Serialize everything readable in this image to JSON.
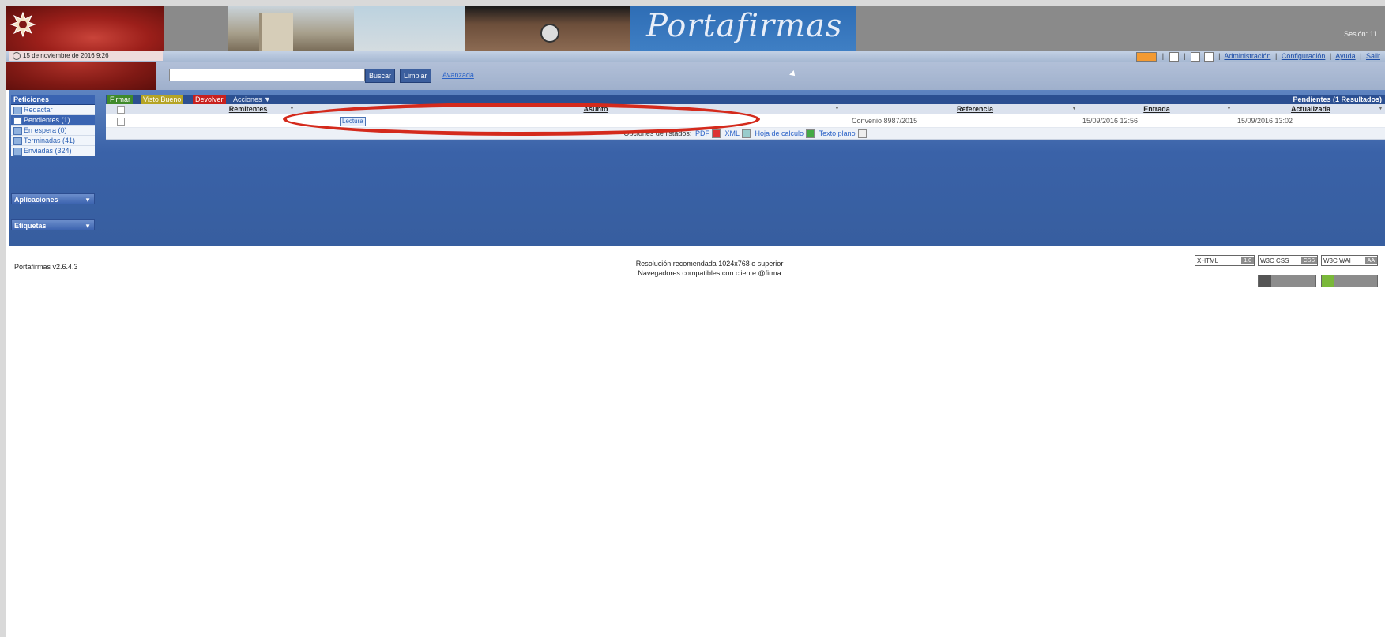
{
  "header": {
    "title": "Portafirmas",
    "user": "",
    "session": "Sesión: 11"
  },
  "date": "15 de noviembre de 2016 9:26",
  "toplinks": [
    "Administración",
    "Configuración",
    "Ayuda",
    "Salir"
  ],
  "search": {
    "value": "",
    "placeholder": "",
    "search_label": "Buscar",
    "clear_label": "Limpiar",
    "advanced_label": "Avanzada"
  },
  "sidebar": {
    "heading": "Peticiones",
    "items": [
      {
        "label": "Redactar"
      },
      {
        "label": "Pendientes (1)"
      },
      {
        "label": "En espera (0)"
      },
      {
        "label": "Terminadas (41)"
      },
      {
        "label": "Enviadas (324)"
      }
    ],
    "apps_label": "Aplicaciones",
    "tags_label": "Etiquetas"
  },
  "actions": {
    "firmar": "Firmar",
    "visto_bueno": "Visto Bueno",
    "devolver": "Devolver",
    "acciones": "Acciones"
  },
  "pending_label": "Pendientes (1 Resultados)",
  "table": {
    "columns": [
      "Remitentes",
      "Asunto",
      "Referencia",
      "Entrada",
      "Actualizada"
    ],
    "rows": [
      {
        "remitente": "",
        "tag": "Lectura",
        "asunto": "",
        "referencia": "Convenio 8987/2015",
        "entrada": "15/09/2016 12:56",
        "actualizada": "15/09/2016 13:02"
      }
    ]
  },
  "export": {
    "label": "Opciones de listados:",
    "options": [
      "PDF",
      "XML",
      "Hoja de calculo",
      "Texto plano"
    ]
  },
  "footer": {
    "version": "Portafirmas v2.6.4.3",
    "resolution": "Resolución recomendada 1024x768 o superior",
    "browsers": "Navegadores compatibles con cliente @firma"
  },
  "badges": [
    "XHTML",
    "W3C CSS",
    "W3C WAI"
  ],
  "colors": {
    "primary_blue": "#3a64b2",
    "firmar_green": "#3f8a2b",
    "visto_yellow": "#b5a425",
    "devolver_red": "#c8201e",
    "annotation_red": "#d42a1c"
  }
}
